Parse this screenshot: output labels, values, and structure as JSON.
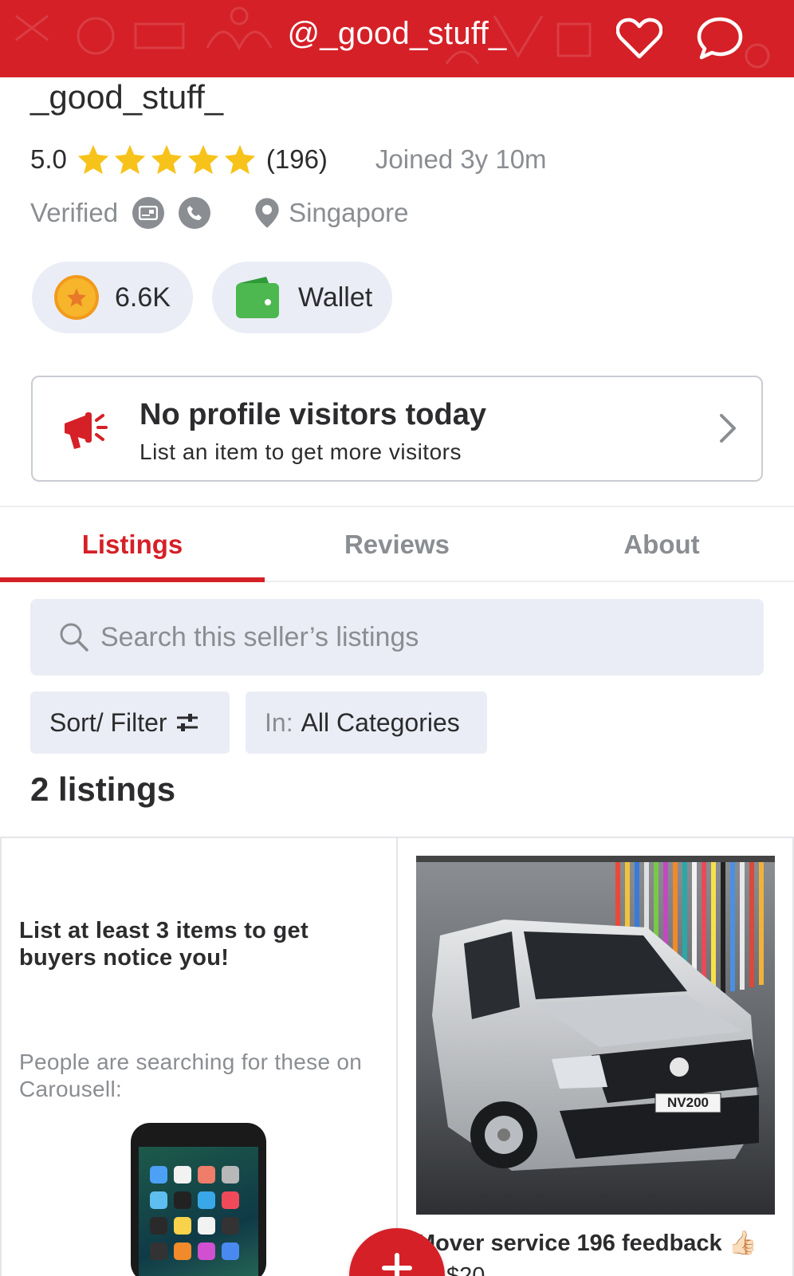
{
  "header": {
    "title": "@_good_stuff_",
    "icons": [
      "heart-icon",
      "chat-bubble-icon"
    ]
  },
  "profile": {
    "name": "_good_stuff_",
    "rating": "5.0",
    "stars": 5,
    "review_count": "(196)",
    "joined": "Joined 3y 10m",
    "verified_label": "Verified",
    "location": "Singapore"
  },
  "pills": {
    "coins_value": "6.6K",
    "wallet_label": "Wallet"
  },
  "banner": {
    "title": "No profile visitors today",
    "subtitle": "List an item to get more visitors"
  },
  "tabs": [
    {
      "label": "Listings",
      "active": true
    },
    {
      "label": "Reviews",
      "active": false
    },
    {
      "label": "About",
      "active": false
    }
  ],
  "search": {
    "placeholder": "Search this seller’s listings"
  },
  "filters": {
    "sort_label": "Sort/ Filter",
    "category_prefix": "In:",
    "category_value": "All Categories"
  },
  "listing_count": "2 listings",
  "promo": {
    "title": "List at least 3 items to get buyers notice you!",
    "subtitle": "People are searching for these on Carousell:"
  },
  "listing": {
    "plate_text": "NV200",
    "title": "Mover service 196 feedback 👍🏻",
    "price_partial": "$20"
  },
  "colors": {
    "brand_red": "#d52027",
    "pill_bg": "#eaedf5",
    "muted_text": "#8a8d91",
    "star_yellow": "#f7c21a",
    "wallet_green": "#4cb84f"
  }
}
